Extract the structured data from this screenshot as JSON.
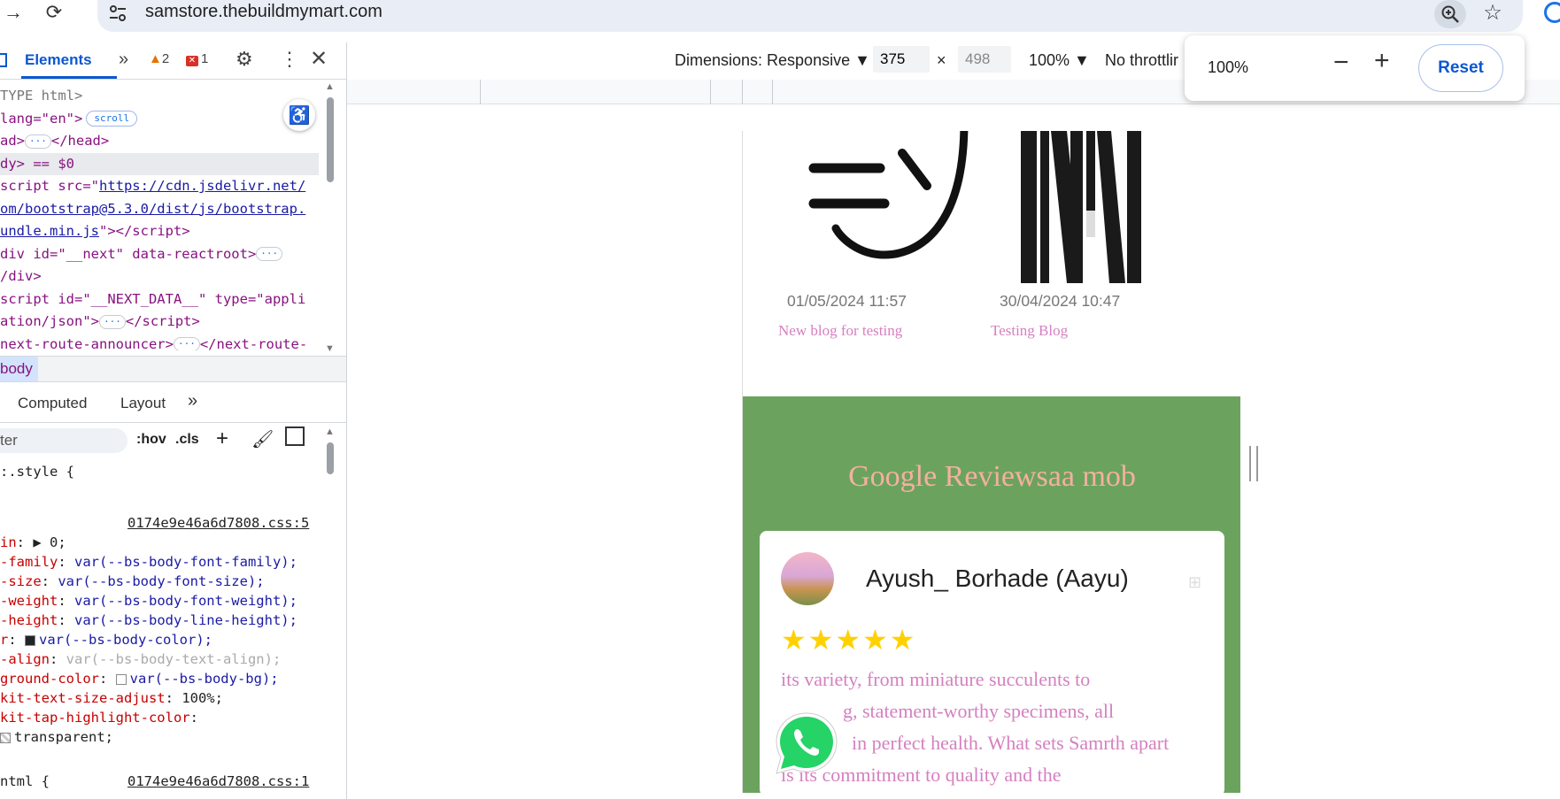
{
  "browser": {
    "url": "samstore.thebuildmymart.com",
    "back_icon": "arrow-forward-icon",
    "reload_icon": "reload-icon",
    "zoom_icon": "zoom-in-icon",
    "bookmark_icon": "star-icon"
  },
  "zoom_popup": {
    "level": "100%",
    "minus": "−",
    "plus": "+",
    "reset_label": "Reset"
  },
  "devtools": {
    "tab_elements": "Elements",
    "more": "»",
    "warnings": "2",
    "errors": "1",
    "dom": [
      "TYPE html>",
      " lang=\"en\">",
      "ad>",
      "dy> == $0",
      "script src=\"",
      "om/bootstrap@5.3.0/dist/js/bootstrap.",
      "undle.min.js",
      "div id=\"__next\" data-reactroot>",
      "/div>",
      "script id=\"__NEXT_DATA__\" type=\"appli",
      "ation/json\">",
      "next-route-announcer>"
    ],
    "dom_link": "https://cdn.jsdelivr.net/",
    "scroll_pill": "scroll",
    "breadcrumb": "body",
    "subtab_computed": "Computed",
    "subtab_layout": "Layout",
    "filter_placeholder": "ter",
    "hov": ":hov",
    "cls": ".cls",
    "styles": {
      "element_style": ":.style {",
      "source1": "0174e9e46a6d7808.css:5",
      "source2": "0174e9e46a6d7808.css:1",
      "rules": [
        {
          "prop": "in",
          "val": "▶ 0;"
        },
        {
          "prop": "-family",
          "val": "var(--bs-body-font-family);"
        },
        {
          "prop": "-size",
          "val": "var(--bs-body-font-size);"
        },
        {
          "prop": "-weight",
          "val": "var(--bs-body-font-weight);"
        },
        {
          "prop": "-height",
          "val": "var(--bs-body-line-height);"
        },
        {
          "prop": "r",
          "val": "var(--bs-body-color);"
        },
        {
          "prop": "-align",
          "val": "var(--bs-body-text-align);"
        },
        {
          "prop": "ground-color",
          "val": "var(--bs-body-bg);"
        },
        {
          "prop": "kit-text-size-adjust",
          "val": "100%;"
        },
        {
          "prop": "kit-tap-highlight-color",
          "val": ""
        },
        {
          "prop": "",
          "val": "transparent;"
        }
      ],
      "html_rule": "ntml {"
    }
  },
  "device_toolbar": {
    "dimensions_label": "Dimensions: Responsive ▼",
    "width": "375",
    "times": "×",
    "height": "498",
    "zoom": "100% ▼",
    "throttling": "No throttlir"
  },
  "page": {
    "blogs": [
      {
        "date": "01/05/2024 11:57",
        "title": "New blog for testing"
      },
      {
        "date": "30/04/2024 10:47",
        "title": "Testing Blog"
      }
    ],
    "reviews_heading": "Google Reviewsaa mob",
    "reviewer": "Ayush_ Borhade (Aayu)",
    "stars": "★★★★★",
    "rating": 5,
    "review_lines": [
      "its variety, from miniature succulents to",
      "g, statement-worthy specimens, all",
      "in perfect health. What sets Samrth apart",
      "is its commitment to quality and the"
    ]
  },
  "colors": {
    "green_section": "#6ba35e",
    "heading": "#f4b0a0",
    "link_pink": "#d580c0",
    "accent_blue": "#0b57d0"
  }
}
